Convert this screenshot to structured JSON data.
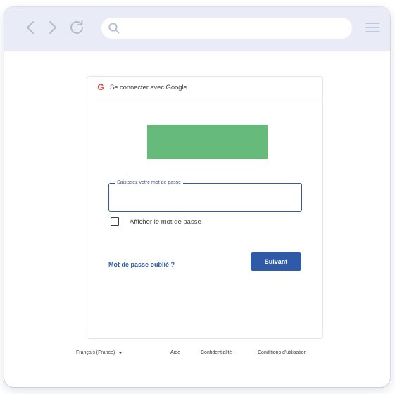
{
  "browser": {
    "address": {
      "placeholder": ""
    },
    "icons": {
      "back": "chevron-left-icon",
      "forward": "chevron-right-icon",
      "reload": "reload-icon",
      "search": "search-icon",
      "menu": "hamburger-menu-icon"
    },
    "colors": {
      "toolbar": "#e9ecf6",
      "icon": "#b4bbd0"
    }
  },
  "login": {
    "header_title": "Se connecter avec Google",
    "google_glyph": "G",
    "password_label": "Saisissez votre mot de passe",
    "password_value": "",
    "show_password_label": "Afficher le mot de passe",
    "show_password_checked": false,
    "forgot_password": "Mot de passe oublié ?",
    "next_button": "Suivant",
    "colors": {
      "accent": "#2e5aa8",
      "logo_placeholder": "#66bb7b",
      "google_red": "#ea4335"
    }
  },
  "footer": {
    "language": "Français (France)",
    "help": "Aide",
    "privacy": "Confidentialité",
    "terms": "Conditions d'utilisation"
  }
}
